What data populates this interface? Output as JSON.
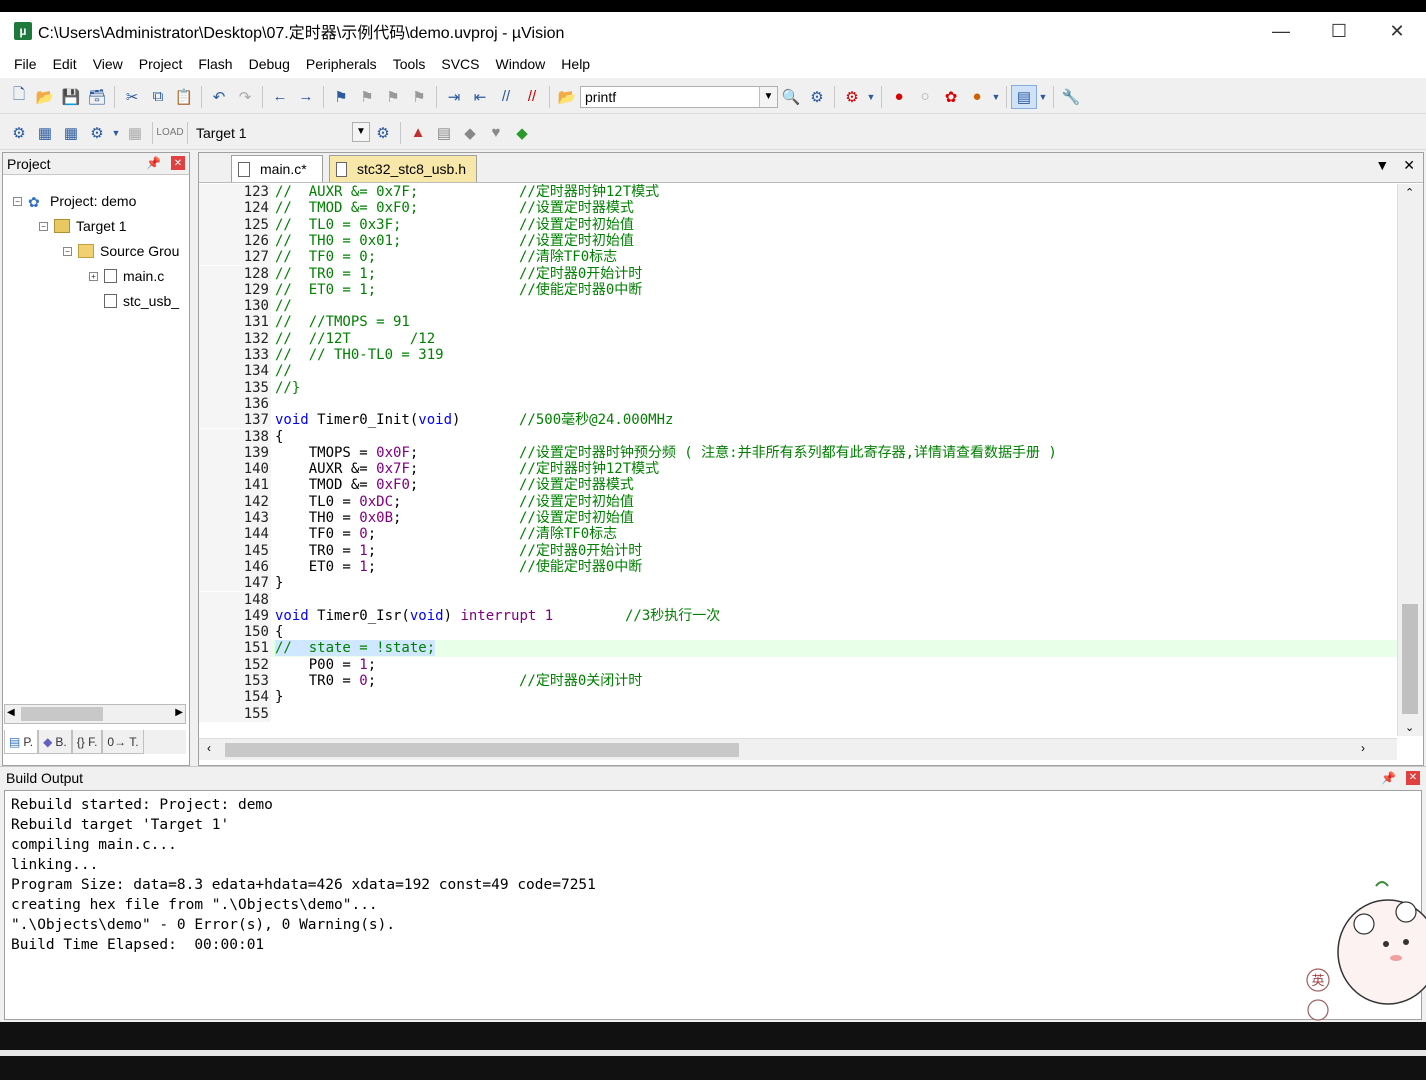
{
  "window": {
    "title": "C:\\Users\\Administrator\\Desktop\\07.定时器\\示例代码\\demo.uvproj - µVision"
  },
  "menu": [
    "File",
    "Edit",
    "View",
    "Project",
    "Flash",
    "Debug",
    "Peripherals",
    "Tools",
    "SVCS",
    "Window",
    "Help"
  ],
  "toolbar": {
    "find_combo_value": "printf",
    "target_combo_value": "Target 1"
  },
  "project_panel": {
    "title": "Project",
    "tree": {
      "project": "Project: demo",
      "target": "Target 1",
      "group": "Source Grou",
      "file1": "main.c",
      "file2": "stc_usb_"
    },
    "tabs": [
      "P.",
      "B.",
      "{} F.",
      "0→ T."
    ]
  },
  "editor": {
    "tabs": [
      {
        "label": "main.c*",
        "active": true
      },
      {
        "label": "stc32_stc8_usb.h",
        "active": false
      }
    ],
    "lines": [
      {
        "n": "123",
        "code": "//  AUXR &= 0x7F;",
        "comment": "//定时器时钟12T模式"
      },
      {
        "n": "124",
        "code": "//  TMOD &= 0xF0;",
        "comment": "//设置定时器模式"
      },
      {
        "n": "125",
        "code": "//  TL0 = 0x3F;",
        "comment": "//设置定时初始值"
      },
      {
        "n": "126",
        "code": "//  TH0 = 0x01;",
        "comment": "//设置定时初始值"
      },
      {
        "n": "127",
        "code": "//  TF0 = 0;",
        "comment": "//清除TF0标志"
      },
      {
        "n": "128",
        "code": "//  TR0 = 1;",
        "comment": "//定时器0开始计时"
      },
      {
        "n": "129",
        "code": "//  ET0 = 1;",
        "comment": "//使能定时器0中断"
      },
      {
        "n": "130",
        "code": "//",
        "comment": ""
      },
      {
        "n": "131",
        "code": "//  //TMOPS = 91",
        "comment": ""
      },
      {
        "n": "132",
        "code": "//  //12T       /12",
        "comment": ""
      },
      {
        "n": "133",
        "code": "//  // TH0-TL0 = 319",
        "comment": ""
      },
      {
        "n": "134",
        "code": "//",
        "comment": ""
      },
      {
        "n": "135",
        "code": "//}",
        "comment": ""
      },
      {
        "n": "136",
        "code": "",
        "comment": ""
      },
      {
        "n": "137",
        "code": "void Timer0_Init(void)",
        "comment": "//500毫秒@24.000MHz"
      },
      {
        "n": "138",
        "code": "{",
        "comment": ""
      },
      {
        "n": "139",
        "code": "    TMOPS = 0x0F;",
        "comment": "//设置定时器时钟预分频 ( 注意:并非所有系列都有此寄存器,详情请查看数据手册 )"
      },
      {
        "n": "140",
        "code": "    AUXR &= 0x7F;",
        "comment": "//定时器时钟12T模式"
      },
      {
        "n": "141",
        "code": "    TMOD &= 0xF0;",
        "comment": "//设置定时器模式"
      },
      {
        "n": "142",
        "code": "    TL0 = 0xDC;",
        "comment": "//设置定时初始值"
      },
      {
        "n": "143",
        "code": "    TH0 = 0x0B;",
        "comment": "//设置定时初始值"
      },
      {
        "n": "144",
        "code": "    TF0 = 0;",
        "comment": "//清除TF0标志"
      },
      {
        "n": "145",
        "code": "    TR0 = 1;",
        "comment": "//定时器0开始计时"
      },
      {
        "n": "146",
        "code": "    ET0 = 1;",
        "comment": "//使能定时器0中断"
      },
      {
        "n": "147",
        "code": "}",
        "comment": ""
      },
      {
        "n": "148",
        "code": "",
        "comment": ""
      },
      {
        "n": "149",
        "code": "void Timer0_Isr(void) interrupt 1",
        "comment": "//3秒执行一次"
      },
      {
        "n": "150",
        "code": "{",
        "comment": ""
      },
      {
        "n": "151",
        "code": "//  state = !state;",
        "comment": ""
      },
      {
        "n": "152",
        "code": "    P00 = 1;",
        "comment": ""
      },
      {
        "n": "153",
        "code": "    TR0 = 0;",
        "comment": "//定时器0关闭计时"
      },
      {
        "n": "154",
        "code": "}",
        "comment": ""
      },
      {
        "n": "155",
        "code": "",
        "comment": ""
      }
    ]
  },
  "build_output": {
    "title": "Build Output",
    "lines": [
      "Rebuild started: Project: demo",
      "Rebuild target 'Target 1'",
      "compiling main.c...",
      "linking...",
      "Program Size: data=8.3 edata+hdata=426 xdata=192 const=49 code=7251",
      "creating hex file from \".\\Objects\\demo\"...",
      "\".\\Objects\\demo\" - 0 Error(s), 0 Warning(s).",
      "Build Time Elapsed:  00:00:01"
    ]
  },
  "ime_indicator": "英",
  "colors": {
    "comment": "#008000",
    "keyword": "#0000ff",
    "number": "#800080",
    "error_red": "#e04040"
  }
}
